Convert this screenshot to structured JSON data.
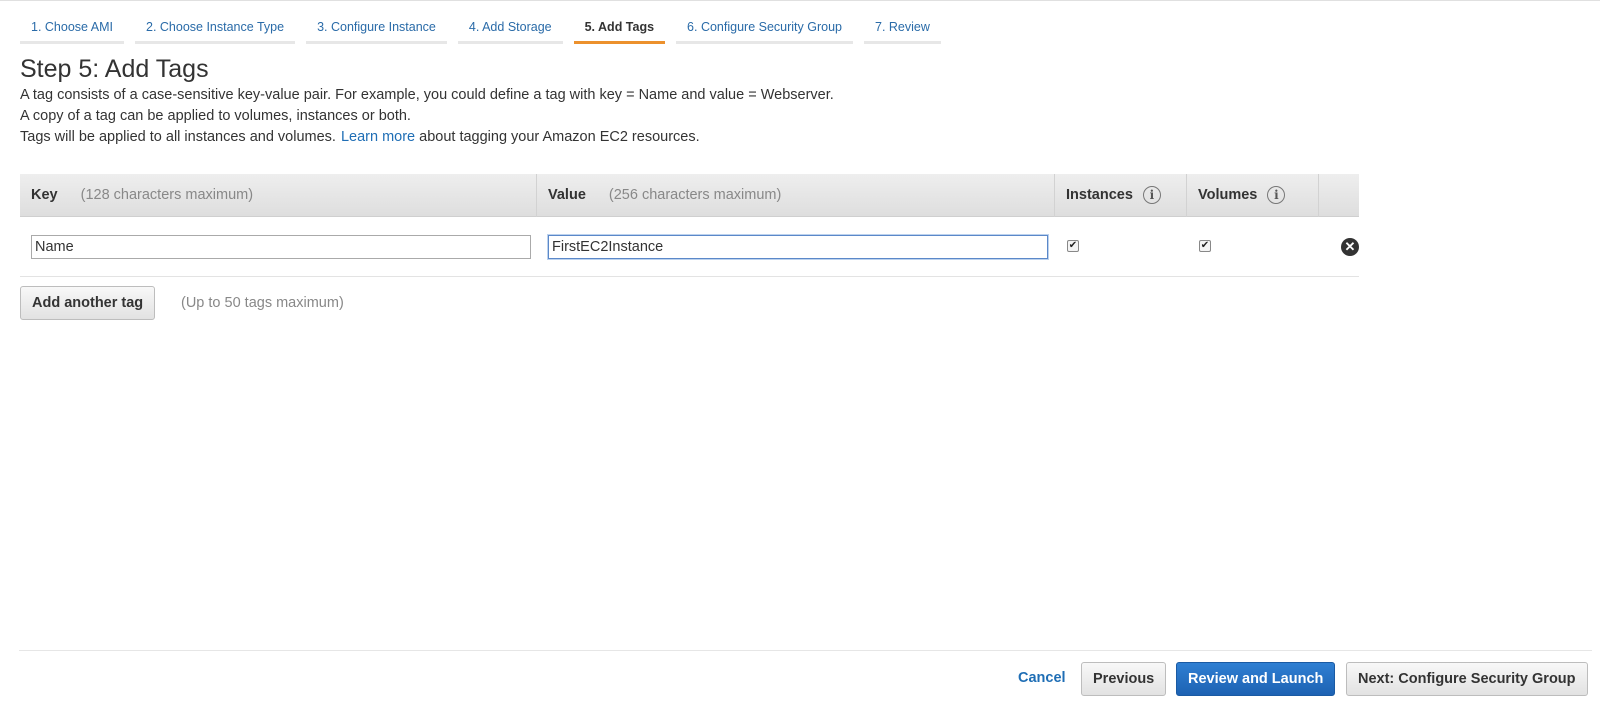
{
  "steps": [
    {
      "label": "1. Choose AMI"
    },
    {
      "label": "2. Choose Instance Type"
    },
    {
      "label": "3. Configure Instance"
    },
    {
      "label": "4. Add Storage"
    },
    {
      "label": "5. Add Tags"
    },
    {
      "label": "6. Configure Security Group"
    },
    {
      "label": "7. Review"
    }
  ],
  "active_step": "5. Add Tags",
  "page": {
    "title": "Step 5: Add Tags",
    "desc_line1": "A tag consists of a case-sensitive key-value pair. For example, you could define a tag with key = Name and value = Webserver.",
    "desc_line2": "A copy of a tag can be applied to volumes, instances or both.",
    "desc_line3_before": "Tags will be applied to all instances and volumes.",
    "learn_more": "Learn more",
    "desc_line3_after": "about tagging your Amazon EC2 resources."
  },
  "table": {
    "headers": {
      "key": "Key",
      "key_hint": "(128 characters maximum)",
      "value": "Value",
      "value_hint": "(256 characters maximum)",
      "instances": "Instances",
      "volumes": "Volumes",
      "info_glyph": "i"
    },
    "rows": [
      {
        "key": "Name",
        "value": "FirstEC2Instance",
        "instances_checked": true,
        "volumes_checked": true
      }
    ]
  },
  "add_tag": {
    "label": "Add another tag",
    "note": "(Up to 50 tags maximum)"
  },
  "footer": {
    "cancel": "Cancel",
    "previous": "Previous",
    "review_launch": "Review and Launch",
    "next": "Next: Configure Security Group"
  },
  "colors": {
    "link": "#1f6eb5",
    "active_tab_underline": "#ec912d",
    "primary_button": "#1d62b3"
  },
  "icons": {
    "checkmark": "✔",
    "remove": "✕"
  }
}
